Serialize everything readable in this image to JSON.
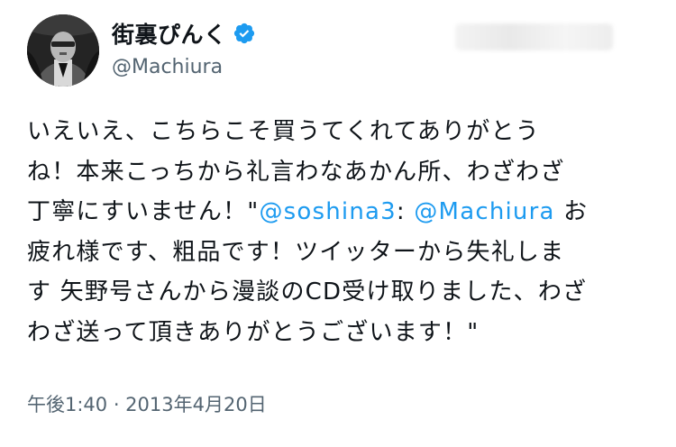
{
  "user": {
    "display_name": "街裏ぴんく",
    "handle": "@Machiura",
    "verified": true,
    "verified_icon": "verified-badge-icon"
  },
  "tweet": {
    "lines": [
      {
        "text": "いえいえ、こちらこそ買うてくれてありがとう"
      },
      {
        "text": "ね！本来こっちから礼言わなあかん所、わざわざ"
      },
      {
        "pre": "丁寧にすいません！\"",
        "mention1": "@soshina3",
        "mid": ": ",
        "mention2": "@Machiura",
        "post": " お"
      },
      {
        "text": "疲れ様です、粗品です！ツイッターから失礼しま"
      },
      {
        "text": "す 矢野号さんから漫談のCD受け取りました、わざ"
      },
      {
        "text": "わざ送って頂きありがとうございます！\""
      }
    ]
  },
  "timestamp": "午後1:40 · 2013年4月20日",
  "colors": {
    "text": "#0f1419",
    "secondary": "#536471",
    "link": "#1d9bf0",
    "verified": "#1d9bf0"
  }
}
